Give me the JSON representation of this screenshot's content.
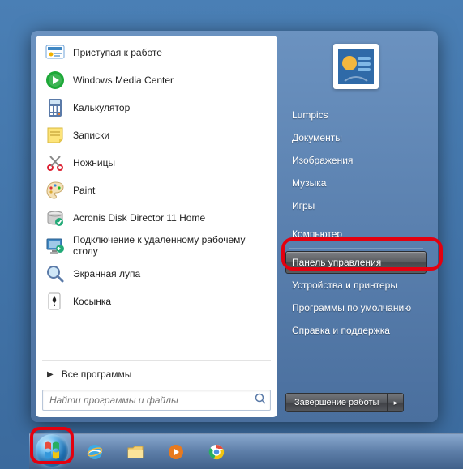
{
  "programs": [
    {
      "label": "Приступая к работе",
      "icon": "getting-started"
    },
    {
      "label": "Windows Media Center",
      "icon": "media-center"
    },
    {
      "label": "Калькулятор",
      "icon": "calculator"
    },
    {
      "label": "Записки",
      "icon": "sticky-notes"
    },
    {
      "label": "Ножницы",
      "icon": "snipping"
    },
    {
      "label": "Paint",
      "icon": "paint"
    },
    {
      "label": "Acronis Disk Director 11 Home",
      "icon": "acronis"
    },
    {
      "label": "Подключение к удаленному рабочему столу",
      "icon": "rdp"
    },
    {
      "label": "Экранная лупа",
      "icon": "magnifier"
    },
    {
      "label": "Косынка",
      "icon": "solitaire"
    }
  ],
  "all_programs": "Все программы",
  "search": {
    "placeholder": "Найти программы и файлы"
  },
  "right": {
    "user": "Lumpics",
    "items_top": [
      "Документы",
      "Изображения",
      "Музыка",
      "Игры"
    ],
    "computer": "Компьютер",
    "control_panel": "Панель управления",
    "devices": "Устройства и принтеры",
    "defaults": "Программы по умолчанию",
    "help": "Справка и поддержка"
  },
  "shutdown": {
    "label": "Завершение работы"
  },
  "taskbar_items": [
    "ie",
    "explorer",
    "wmp",
    "chrome"
  ]
}
